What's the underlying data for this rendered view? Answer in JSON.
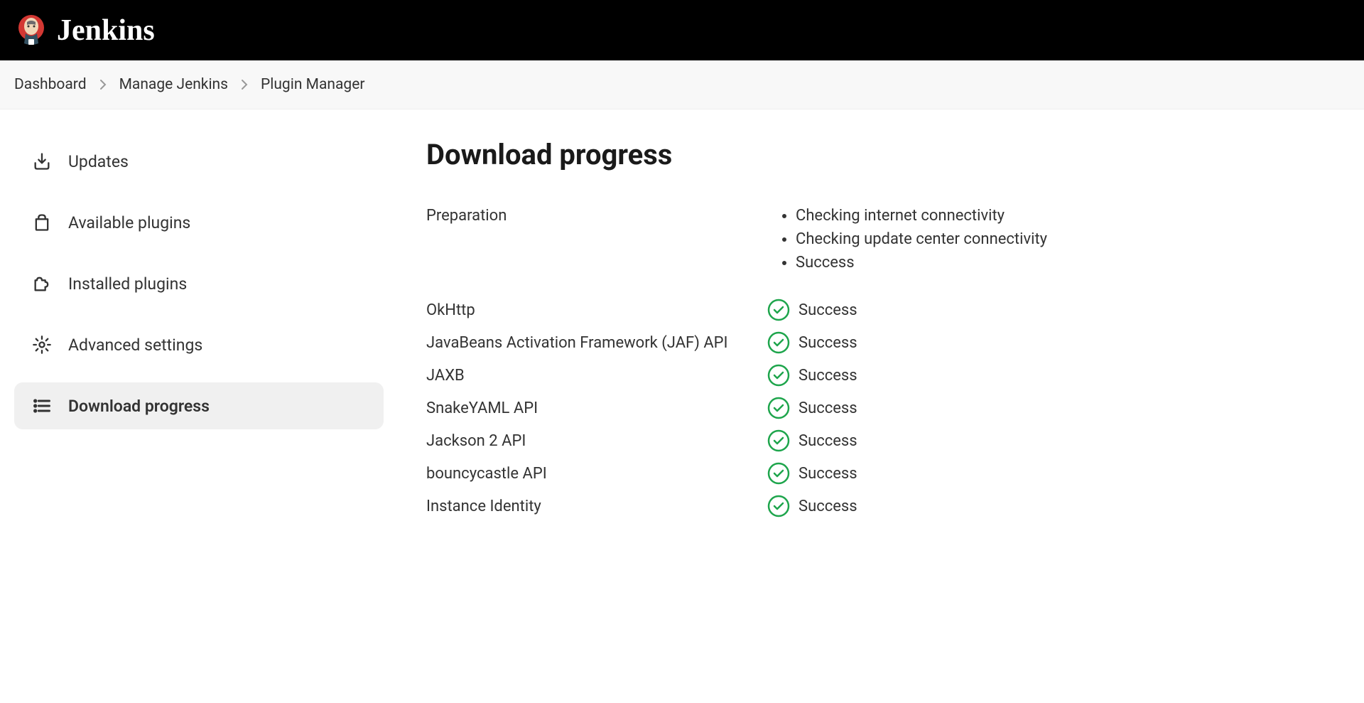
{
  "header": {
    "app_name": "Jenkins"
  },
  "breadcrumbs": [
    {
      "label": "Dashboard"
    },
    {
      "label": "Manage Jenkins"
    },
    {
      "label": "Plugin Manager"
    }
  ],
  "sidebar": {
    "items": [
      {
        "label": "Updates",
        "icon": "download-icon",
        "active": false
      },
      {
        "label": "Available plugins",
        "icon": "shopping-bag-icon",
        "active": false
      },
      {
        "label": "Installed plugins",
        "icon": "puzzle-icon",
        "active": false
      },
      {
        "label": "Advanced settings",
        "icon": "gear-icon",
        "active": false
      },
      {
        "label": "Download progress",
        "icon": "list-icon",
        "active": true
      }
    ]
  },
  "main": {
    "title": "Download progress",
    "preparation": {
      "label": "Preparation",
      "steps": [
        "Checking internet connectivity",
        "Checking update center connectivity",
        "Success"
      ]
    },
    "plugins": [
      {
        "name": "OkHttp",
        "status": "Success"
      },
      {
        "name": "JavaBeans Activation Framework (JAF) API",
        "status": "Success"
      },
      {
        "name": "JAXB",
        "status": "Success"
      },
      {
        "name": "SnakeYAML API",
        "status": "Success"
      },
      {
        "name": "Jackson 2 API",
        "status": "Success"
      },
      {
        "name": "bouncycastle API",
        "status": "Success"
      },
      {
        "name": "Instance Identity",
        "status": "Success"
      }
    ]
  }
}
